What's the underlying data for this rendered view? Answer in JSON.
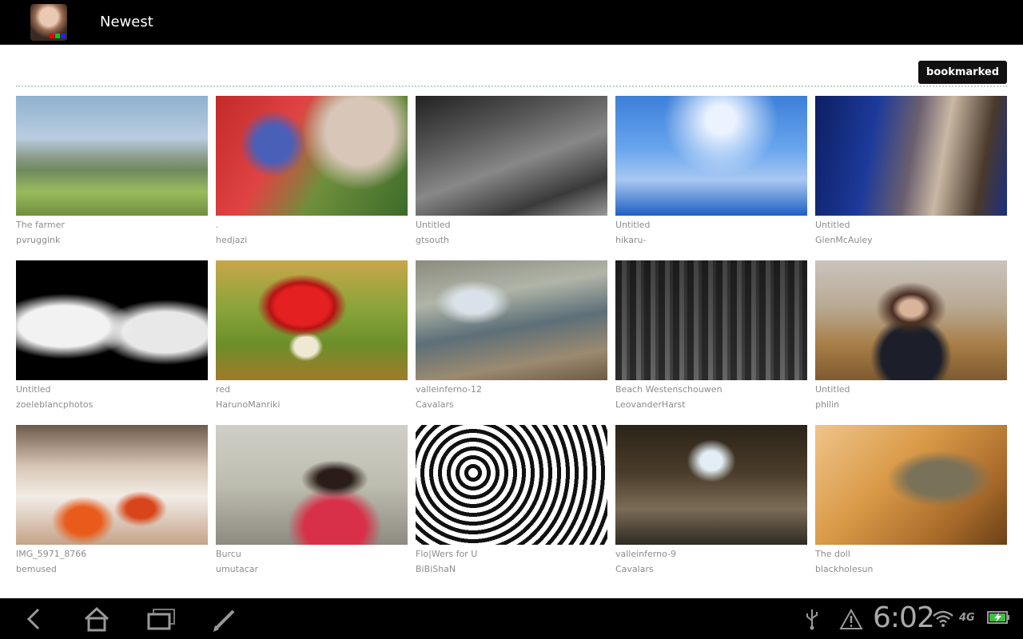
{
  "header": {
    "title": "Newest"
  },
  "toolbar": {
    "bookmarked_label": "bookmarked"
  },
  "photos": [
    {
      "title": "The farmer",
      "user": "pvruggink"
    },
    {
      "title": ".",
      "user": "hedjazi"
    },
    {
      "title": "Untitled",
      "user": "gtsouth"
    },
    {
      "title": "Untitled",
      "user": "hikaru-"
    },
    {
      "title": "Untitled",
      "user": "GlenMcAuley"
    },
    {
      "title": "Untitled",
      "user": "zoeleblancphotos"
    },
    {
      "title": "red",
      "user": "HarunoManriki"
    },
    {
      "title": "valleinferno-12",
      "user": "Cavalars"
    },
    {
      "title": "Beach Westenschouwen",
      "user": "LeovanderHarst"
    },
    {
      "title": "Untitled",
      "user": "philin"
    },
    {
      "title": "IMG_5971_8766",
      "user": "bemused"
    },
    {
      "title": "Burcu",
      "user": "umutacar"
    },
    {
      "title": "Flo|Wers for U",
      "user": "BiBiShaN"
    },
    {
      "title": "valleinferno-9",
      "user": "Cavalars"
    },
    {
      "title": "The doll",
      "user": "blackholesun"
    }
  ],
  "system_bar": {
    "time": "6:02",
    "network": "4G",
    "icons": [
      "back-icon",
      "home-icon",
      "recent-apps-icon",
      "edit-icon",
      "usb-icon",
      "warning-icon",
      "wifi-icon",
      "battery-icon"
    ]
  }
}
